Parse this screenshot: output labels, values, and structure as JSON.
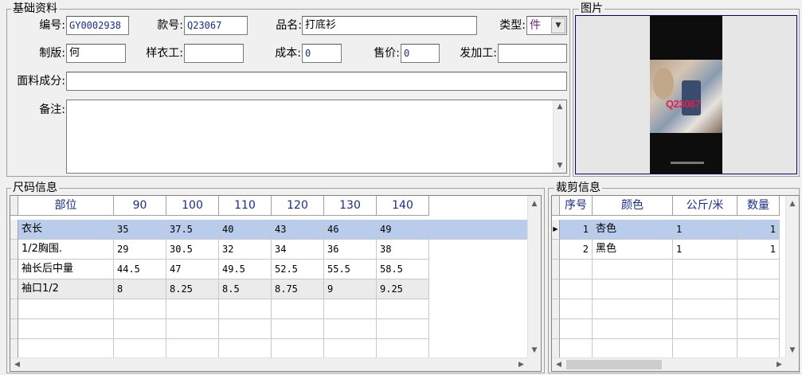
{
  "basic": {
    "legend": "基础资料",
    "labels": {
      "code": "编号:",
      "style": "款号:",
      "name": "品名:",
      "type": "类型:",
      "pattern": "制版:",
      "sample": "样衣工:",
      "cost": "成本:",
      "price": "售价:",
      "outsource": "发加工:",
      "fabric": "面料成分:",
      "remark": "备注:"
    },
    "values": {
      "code": "GY0002938",
      "style": "Q23067",
      "name": "打底衫",
      "type": "件",
      "pattern": "何",
      "sample": "",
      "cost": "0",
      "price": "0",
      "outsource": "",
      "fabric": "",
      "remark": ""
    }
  },
  "picture": {
    "legend": "图片",
    "overlay_text": "Q23067"
  },
  "size": {
    "legend": "尺码信息",
    "headers": [
      "部位",
      "90",
      "100",
      "110",
      "120",
      "130",
      "140"
    ],
    "rows": [
      [
        "衣长",
        "35",
        "37.5",
        "40",
        "43",
        "46",
        "49"
      ],
      [
        "1/2胸围.",
        "29",
        "30.5",
        "32",
        "34",
        "36",
        "38"
      ],
      [
        "袖长后中量",
        "44.5",
        "47",
        "49.5",
        "52.5",
        "55.5",
        "58.5"
      ],
      [
        "袖口1/2",
        "8",
        "8.25",
        "8.5",
        "8.75",
        "9",
        "9.25"
      ]
    ]
  },
  "cut": {
    "legend": "裁剪信息",
    "headers": [
      "序号",
      "颜色",
      "公斤/米",
      "数量"
    ],
    "rows": [
      [
        "1",
        "杏色",
        "1",
        "1"
      ],
      [
        "2",
        "黑色",
        "1",
        "1"
      ]
    ]
  },
  "colors": {
    "selected_row": "#b9ccec",
    "header_text": "#1a2b8c",
    "window_bg": "#f0f0f0"
  }
}
